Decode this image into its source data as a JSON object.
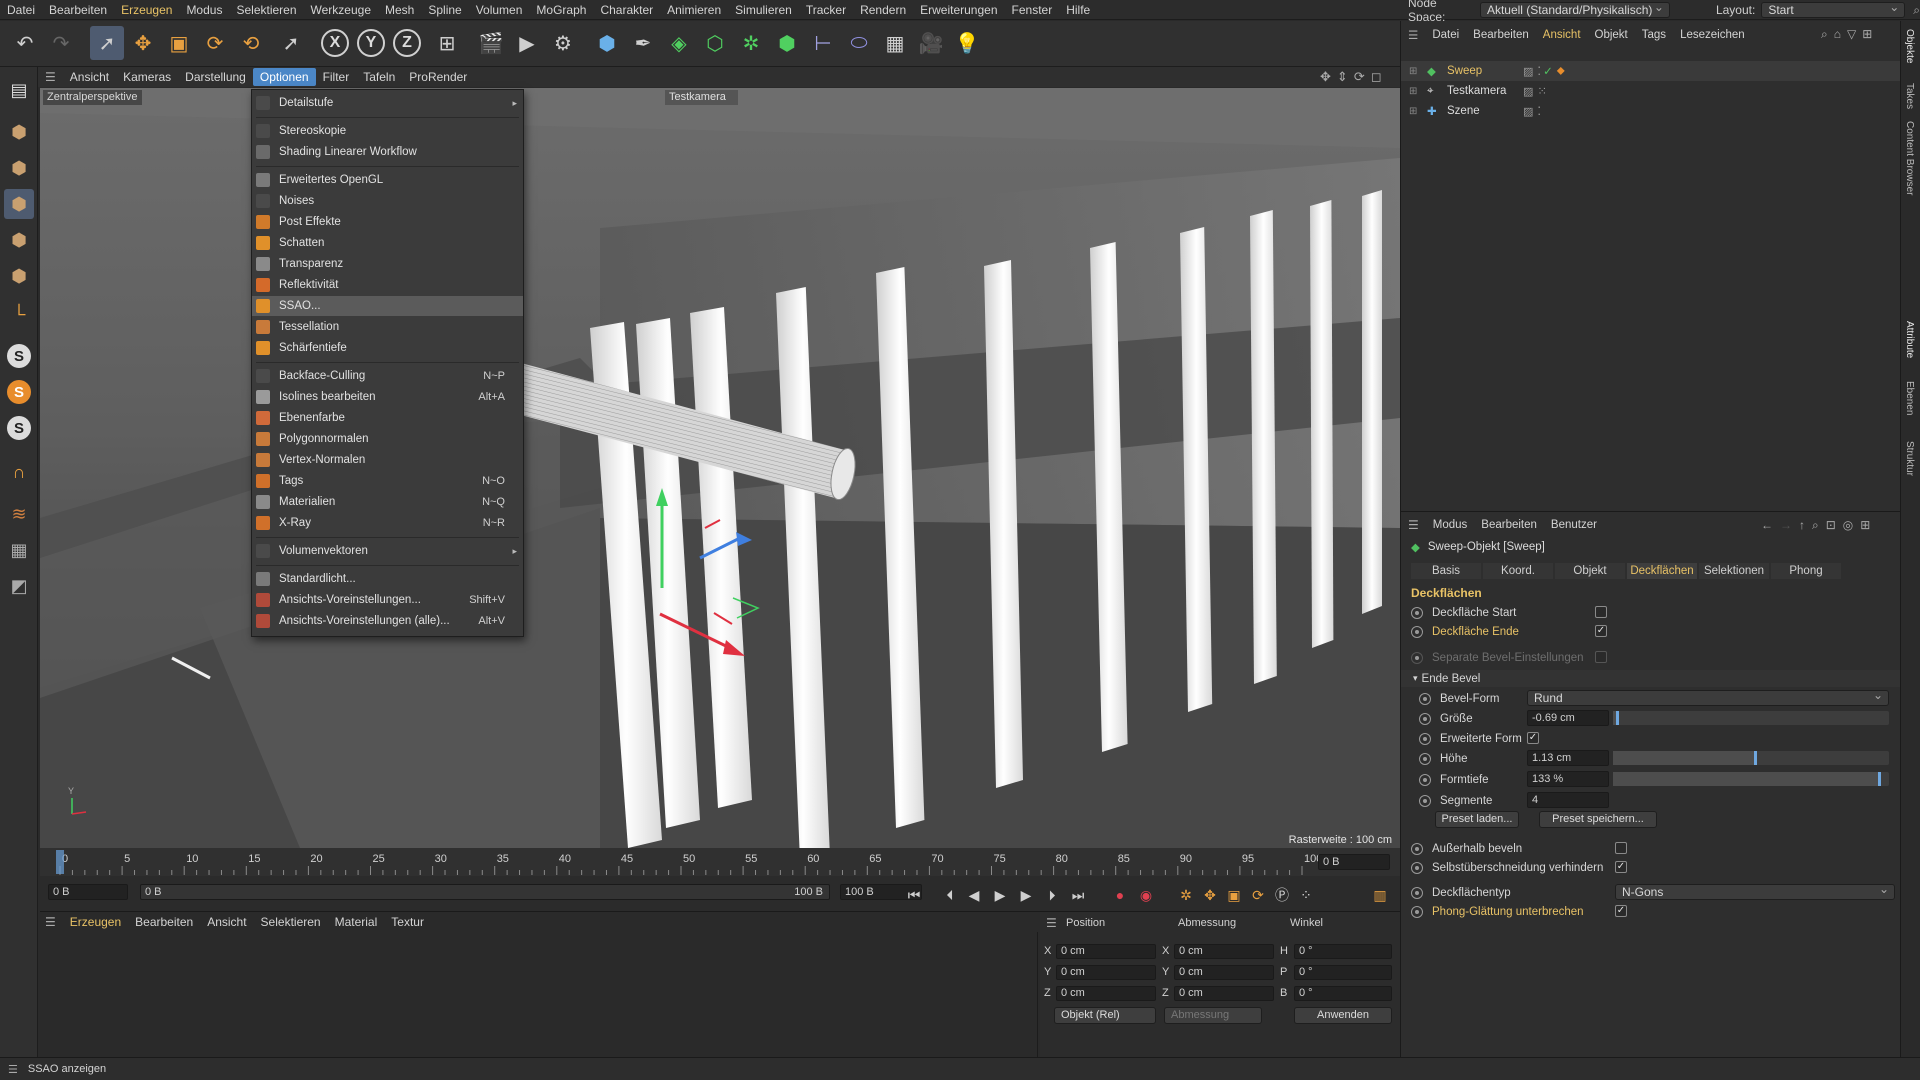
{
  "menubar": {
    "items": [
      "Datei",
      "Bearbeiten",
      "Erzeugen",
      "Modus",
      "Selektieren",
      "Werkzeuge",
      "Mesh",
      "Spline",
      "Volumen",
      "MoGraph",
      "Charakter",
      "Animieren",
      "Simulieren",
      "Tracker",
      "Rendern",
      "Erweiterungen",
      "Fenster",
      "Hilfe"
    ],
    "node_space_label": "Node Space:",
    "node_space_value": "Aktuell (Standard/Physikalisch)",
    "layout_label": "Layout:",
    "layout_value": "Start"
  },
  "viewport_menu": {
    "items": [
      "Ansicht",
      "Kameras",
      "Darstellung",
      "Optionen",
      "Filter",
      "Tafeln",
      "ProRender"
    ],
    "active": "Optionen"
  },
  "viewport": {
    "projection_label": "Zentralperspektive",
    "camera_label": "Testkamera",
    "grid_label": "Rasterweite : 100 cm"
  },
  "options_menu": {
    "items": [
      {
        "label": "Detailstufe",
        "shortcut": "",
        "submenu": true,
        "icon": "blank",
        "color": "#4a4a4a"
      },
      {
        "label": "Stereoskopie",
        "shortcut": "",
        "icon": "blank",
        "color": "#4a4a4a"
      },
      {
        "label": "Shading Linearer Workflow",
        "shortcut": "",
        "icon": "blank",
        "color": "#6a6a6a"
      },
      {
        "label": "Erweitertes OpenGL",
        "shortcut": "",
        "icon": "gl-icon",
        "color": "#7a7a7a"
      },
      {
        "label": "Noises",
        "shortcut": "",
        "icon": "blank",
        "color": "#4a4a4a"
      },
      {
        "label": "Post Effekte",
        "shortcut": "",
        "icon": "fx-icon",
        "color": "#d07a2a"
      },
      {
        "label": "Schatten",
        "shortcut": "",
        "icon": "sphere-icon",
        "color": "#e0902a"
      },
      {
        "label": "Transparenz",
        "shortcut": "",
        "icon": "sphere-icon",
        "color": "#8a8a8a"
      },
      {
        "label": "Reflektivität",
        "shortcut": "",
        "icon": "reflect-icon",
        "color": "#d46a2a"
      },
      {
        "label": "SSAO...",
        "shortcut": "",
        "icon": "sphere-icon",
        "color": "#e0902a",
        "highlight": true
      },
      {
        "label": "Tessellation",
        "shortcut": "",
        "icon": "tess-icon",
        "color": "#c87a3a"
      },
      {
        "label": "Schärfentiefe",
        "shortcut": "",
        "icon": "dof-icon",
        "color": "#e0902a"
      },
      {
        "label": "Backface-Culling",
        "shortcut": "N~P",
        "icon": "blank",
        "color": "#4a4a4a"
      },
      {
        "label": "Isolines bearbeiten",
        "shortcut": "Alt+A",
        "icon": "isoline-icon",
        "color": "#9a9a9a"
      },
      {
        "label": "Ebenenfarbe",
        "shortcut": "",
        "icon": "layer-icon",
        "color": "#d06a3a"
      },
      {
        "label": "Polygonnormalen",
        "shortcut": "",
        "icon": "normal-icon",
        "color": "#c87a3a"
      },
      {
        "label": "Vertex-Normalen",
        "shortcut": "",
        "icon": "normal-icon",
        "color": "#c87a3a"
      },
      {
        "label": "Tags",
        "shortcut": "N~O",
        "icon": "tag-icon",
        "color": "#d0702a"
      },
      {
        "label": "Materialien",
        "shortcut": "N~Q",
        "icon": "checker-icon",
        "color": "#8a8a8a"
      },
      {
        "label": "X-Ray",
        "shortcut": "N~R",
        "icon": "xray-icon",
        "color": "#d0702a"
      },
      {
        "label": "Volumenvektoren",
        "shortcut": "",
        "submenu": true,
        "icon": "blank",
        "color": "#4a4a4a"
      },
      {
        "label": "Standardlicht...",
        "shortcut": "",
        "icon": "light-icon",
        "color": "#7a7a7a"
      },
      {
        "label": "Ansichts-Voreinstellungen...",
        "shortcut": "Shift+V",
        "icon": "preset-icon",
        "color": "#b04a3a"
      },
      {
        "label": "Ansichts-Voreinstellungen (alle)...",
        "shortcut": "Alt+V",
        "icon": "preset-icon",
        "color": "#b04a3a"
      }
    ]
  },
  "timeline": {
    "ticks": [
      "0",
      "5",
      "10",
      "15",
      "20",
      "25",
      "30",
      "35",
      "40",
      "45",
      "50",
      "55",
      "60",
      "65",
      "70",
      "75",
      "80",
      "85",
      "90",
      "95",
      "100"
    ],
    "frame_field": "0 B"
  },
  "transport": {
    "start": "0 B",
    "current": "0 B",
    "end": "100 B",
    "end2": "100 B"
  },
  "material_menu": {
    "items": [
      "Erzeugen",
      "Bearbeiten",
      "Ansicht",
      "Selektieren",
      "Material",
      "Textur"
    ]
  },
  "coords": {
    "headers": [
      "Position",
      "Abmessung",
      "Winkel"
    ],
    "rows": [
      {
        "axis": "X",
        "pos": "0 cm",
        "size_axis": "X",
        "size": "0 cm",
        "rot_axis": "H",
        "rot": "0 °"
      },
      {
        "axis": "Y",
        "pos": "0 cm",
        "size_axis": "Y",
        "size": "0 cm",
        "rot_axis": "P",
        "rot": "0 °"
      },
      {
        "axis": "Z",
        "pos": "0 cm",
        "size_axis": "Z",
        "size": "0 cm",
        "rot_axis": "B",
        "rot": "0 °"
      }
    ],
    "mode": "Objekt (Rel)",
    "size_mode": "Abmessung",
    "apply": "Anwenden"
  },
  "status": {
    "text": "SSAO anzeigen"
  },
  "object_manager": {
    "menu": [
      "Datei",
      "Bearbeiten",
      "Ansicht",
      "Objekt",
      "Tags",
      "Lesezeichen"
    ],
    "objects": [
      {
        "name": "Sweep",
        "selected": true,
        "color": "#e8c266"
      },
      {
        "name": "Testkamera",
        "selected": false,
        "color": "#dcdcdc"
      },
      {
        "name": "Szene",
        "selected": false,
        "color": "#dcdcdc"
      }
    ]
  },
  "attributes": {
    "menu": [
      "Modus",
      "Bearbeiten",
      "Benutzer"
    ],
    "object_title": "Sweep-Objekt [Sweep]",
    "tabs": [
      "Basis",
      "Koord.",
      "Objekt",
      "Deckflächen",
      "Selektionen",
      "Phong"
    ],
    "active_tab": "Deckflächen",
    "section": "Deckflächen",
    "fields": {
      "cap_start": "Deckfläche Start",
      "cap_end": "Deckfläche Ende",
      "separate_bevel": "Separate Bevel-Einstellungen",
      "end_bevel": "Ende Bevel",
      "bevel_shape_label": "Bevel-Form",
      "bevel_shape_value": "Rund",
      "size_label": "Größe",
      "size_value": "-0.69 cm",
      "extended_label": "Erweiterte Form",
      "height_label": "Höhe",
      "height_value": "1.13 cm",
      "depth_label": "Formtiefe",
      "depth_value": "133 %",
      "segments_label": "Segmente",
      "segments_value": "4",
      "preset_load": "Preset laden...",
      "preset_save": "Preset speichern...",
      "outside_bevel": "Außerhalb beveln",
      "self_intersect": "Selbstüberschneidung verhindern",
      "cap_type_label": "Deckflächentyp",
      "cap_type_value": "N-Gons",
      "phong_break": "Phong-Glättung unterbrechen"
    },
    "slider_levels": {
      "size": 0.02,
      "height": 0.52,
      "depth": 0.97
    }
  },
  "side_tabs": [
    "Objekte",
    "Takes",
    "Content Browser",
    "Attribute",
    "Ebenen",
    "Struktur"
  ]
}
